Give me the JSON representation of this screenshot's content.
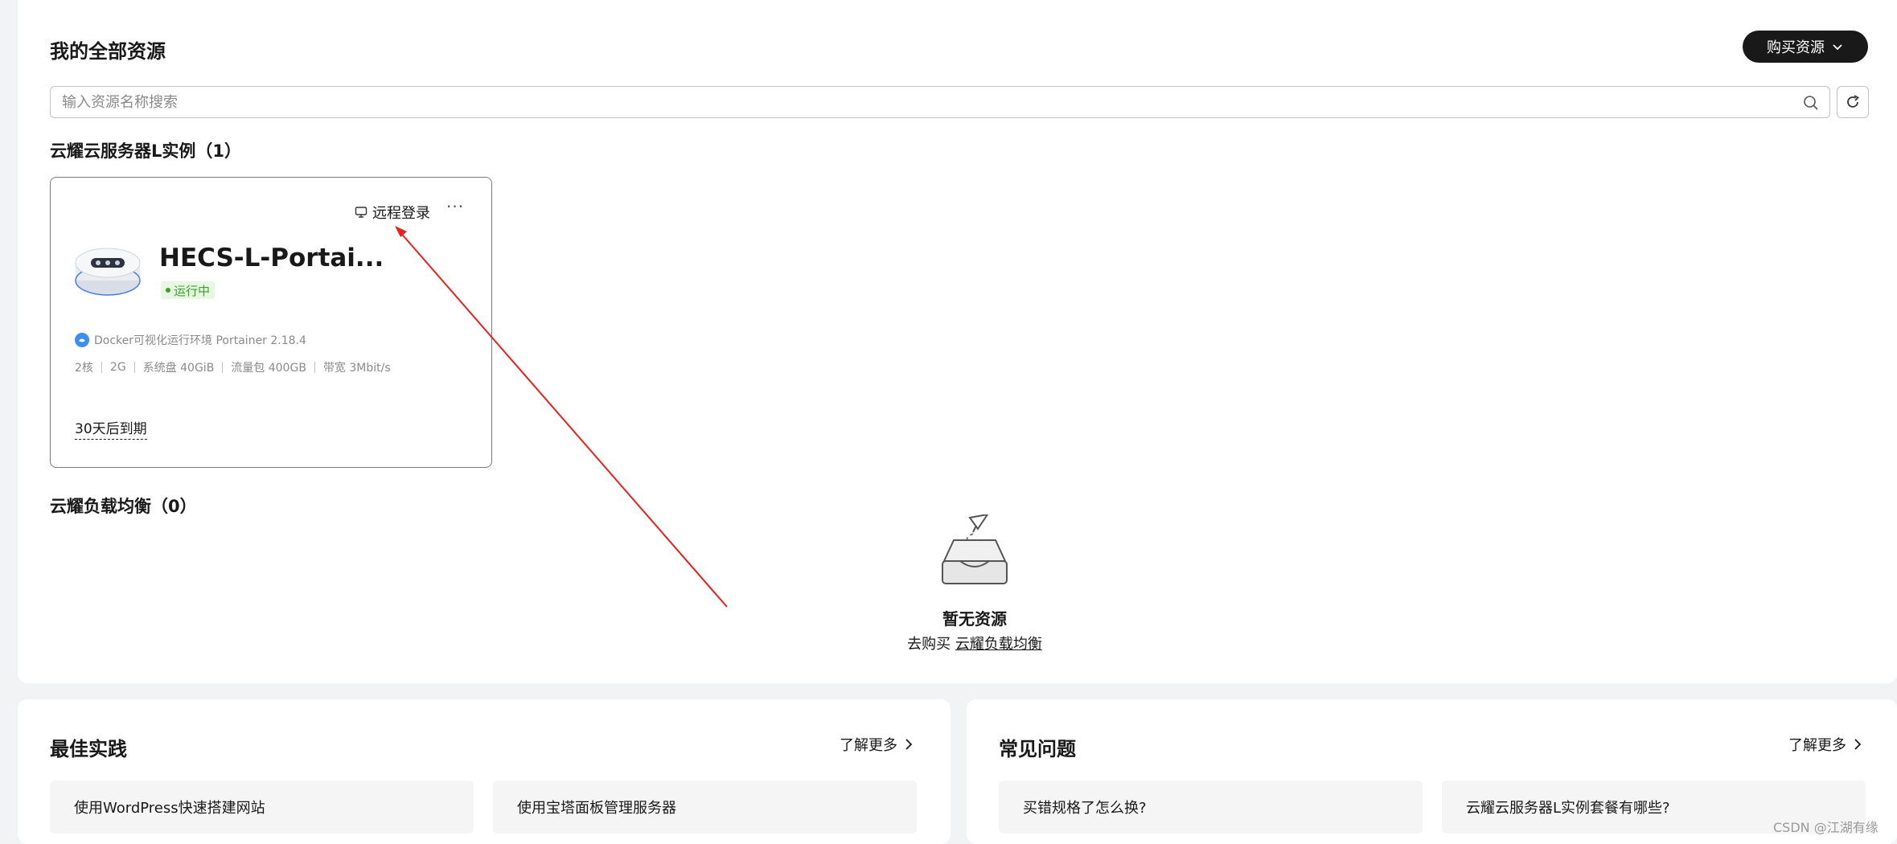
{
  "header": {
    "title": "我的全部资源",
    "buy_button_label": "购买资源"
  },
  "search": {
    "placeholder": "输入资源名称搜索",
    "value": ""
  },
  "sections": {
    "instances_title": "云耀云服务器L实例（1）",
    "lb_title": "云耀负载均衡（0）"
  },
  "instance_card": {
    "remote_login_label": "远程登录",
    "more_label": "···",
    "name": "HECS-L-Portai...",
    "status": "运行中",
    "image_desc": "Docker可视化运行环境 Portainer 2.18.4",
    "specs": [
      "2核",
      "2G",
      "系统盘 40GiB",
      "流量包 400GB",
      "带宽 3Mbit/s"
    ],
    "expire_text": "30天后到期"
  },
  "empty_state": {
    "title": "暂无资源",
    "prefix": "去购买",
    "link_text": "云耀负载均衡"
  },
  "best_practice": {
    "title": "最佳实践",
    "more_label": "了解更多",
    "items": [
      "使用WordPress快速搭建网站",
      "使用宝塔面板管理服务器"
    ]
  },
  "faq": {
    "title": "常见问题",
    "more_label": "了解更多",
    "items": [
      "买错规格了怎么换?",
      "云耀云服务器L实例套餐有哪些?"
    ]
  },
  "watermark": "CSDN @江湖有缘",
  "colors": {
    "accent_dark": "#191919",
    "status_green": "#3ba324",
    "annotation_red": "#e82020"
  }
}
